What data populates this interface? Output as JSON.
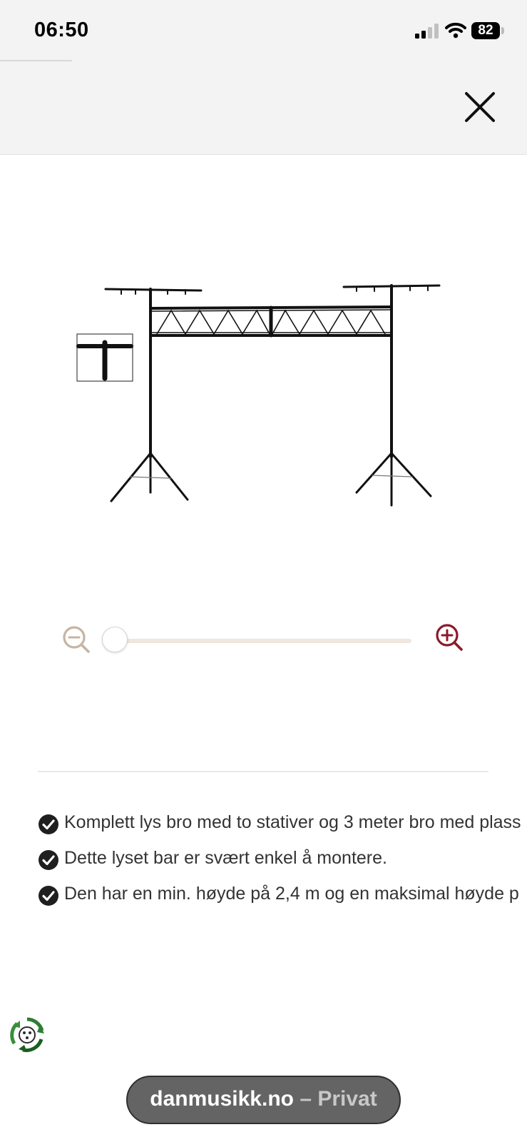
{
  "status_bar": {
    "time": "06:50",
    "battery": "82",
    "icons": [
      "signal-icon",
      "wifi-icon",
      "battery-icon"
    ]
  },
  "header": {
    "close_icon": "close-icon"
  },
  "product": {
    "image_icon": "lighting-stand-truss-image"
  },
  "zoom": {
    "zoom_out_icon": "zoom-out-icon",
    "zoom_in_icon": "zoom-in-icon",
    "level": 0,
    "accent_color": "#8b1a2b",
    "muted_color": "#c5b5a2"
  },
  "features": [
    {
      "text": "Komplett lys bro med to stativer og 3 meter bro med plass",
      "icon": "check-circle-icon"
    },
    {
      "text": "Dette lyset bar er svært enkel å montere.",
      "icon": "check-circle-icon"
    },
    {
      "text": "Den har en min. høyde på 2,4 m og en maksimal høyde p",
      "icon": "check-circle-icon"
    }
  ],
  "eco_badge": {
    "icon": "recycle-badge-icon"
  },
  "browser": {
    "domain": "danmusikk.no",
    "separator": " – ",
    "mode": "Privat"
  }
}
